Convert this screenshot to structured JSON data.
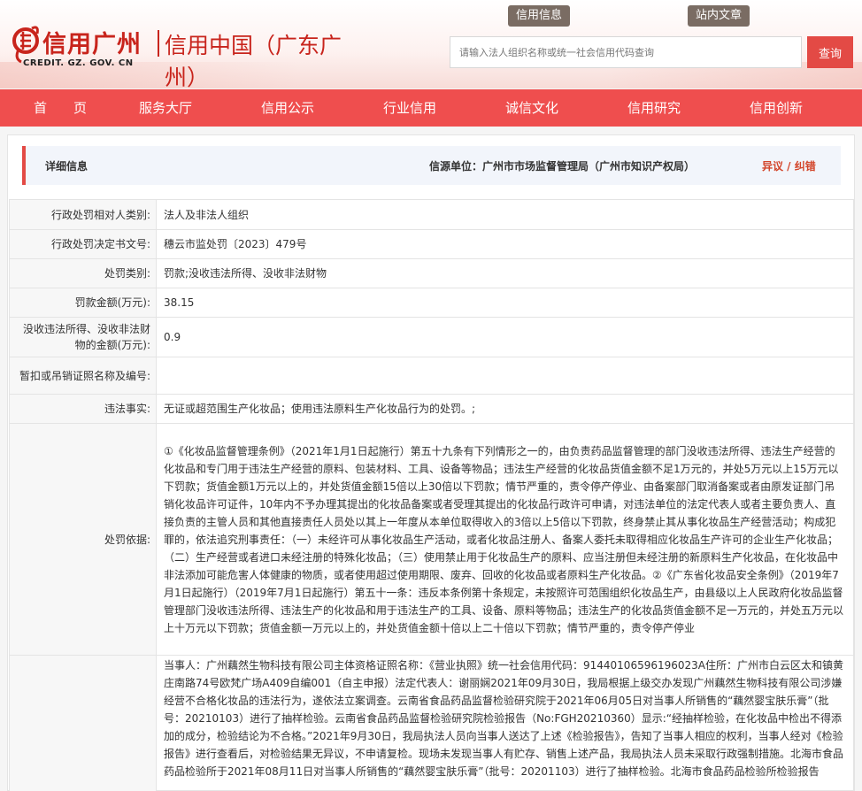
{
  "header": {
    "logo_name": "信用广州",
    "logo_domain": "CREDIT. GZ. GOV. CN",
    "logo_sub": "信用中国（广东广州）",
    "top_links": [
      "信用信息",
      "站内文章"
    ],
    "search_placeholder": "请输入法人组织名称或统一社会信用代码查询",
    "search_button": "查询"
  },
  "nav": {
    "items": [
      "首　　页",
      "服务大厅",
      "信用公示",
      "行业信用",
      "诚信文化",
      "信用研究",
      "信用创新"
    ]
  },
  "detail": {
    "title": "详细信息",
    "source": "信源单位：广州市市场监督管理局（广州市知识产权局）",
    "objection": "异议 / 纠错",
    "rows": [
      {
        "label": "行政处罚相对人类别:",
        "value": "法人及非法人组织"
      },
      {
        "label": "行政处罚决定书文号:",
        "value": "穗云市监处罚〔2023〕479号"
      },
      {
        "label": "处罚类别:",
        "value": "罚款;没收违法所得、没收非法财物"
      },
      {
        "label": "罚款金额(万元):",
        "value": "38.15"
      },
      {
        "label": "没收违法所得、没收非法财物的金额(万元):",
        "value": "0.9"
      },
      {
        "label": "暂扣或吊销证照名称及编号:",
        "value": ""
      },
      {
        "label": "违法事实:",
        "value": "无证或超范围生产化妆品；使用违法原料生产化妆品行为的处罚。;"
      },
      {
        "label": "处罚依据:",
        "value": "①《化妆品监督管理条例》（2021年1月1日起施行）第五十九条有下列情形之一的，由负责药品监督管理的部门没收违法所得、违法生产经营的化妆品和专门用于违法生产经营的原料、包装材料、工具、设备等物品；违法生产经营的化妆品货值金额不足1万元的，并处5万元以上15万元以下罚款；货值金额1万元以上的，并处货值金额15倍以上30倍以下罚款；情节严重的，责令停产停业、由备案部门取消备案或者由原发证部门吊销化妆品许可证件，10年内不予办理其提出的化妆品备案或者受理其提出的化妆品行政许可申请，对违法单位的法定代表人或者主要负责人、直接负责的主管人员和其他直接责任人员处以其上一年度从本单位取得收入的3倍以上5倍以下罚款，终身禁止其从事化妆品生产经营活动；构成犯罪的，依法追究刑事责任：（一）未经许可从事化妆品生产活动，或者化妆品注册人、备案人委托未取得相应化妆品生产许可的企业生产化妆品；（二）生产经营或者进口未经注册的特殊化妆品；（三）使用禁止用于化妆品生产的原料、应当注册但未经注册的新原料生产化妆品，在化妆品中非法添加可能危害人体健康的物质，或者使用超过使用期限、废弃、回收的化妆品或者原料生产化妆品。②《广东省化妆品安全条例》（2019年7月1日起施行）（2019年7月1日起施行）第五十一条：违反本条例第十条规定，未按照许可范围组织化妆品生产，由县级以上人民政府化妆品监督管理部门没收违法所得、违法生产的化妆品和用于违法生产的工具、设备、原料等物品；违法生产的化妆品货值金额不足一万元的，并处五万元以上十万元以下罚款；货值金额一万元以上的，并处货值金额十倍以上二十倍以下罚款；情节严重的，责令停产停业"
      },
      {
        "label": "",
        "value": "当事人：广州藕然生物科技有限公司主体资格证照名称：《营业执照》统一社会信用代码：91440106596196023A住所：广州市白云区太和镇黄庄南路74号欧梵广场A409自编001（自主申报）法定代表人：谢丽娴2021年09月30日，我局根据上级交办发现广州藕然生物科技有限公司涉嫌经营不合格化妆品的违法行为，遂依法立案调查。云南省食品药品监督检验研究院于2021年06月05日对当事人所销售的“藕然婴宝肤乐膏”（批号：20210103）进行了抽样检验。云南省食品药品监督检验研究院检验报告（No:FGH20210360）显示:“经抽样检验，在化妆品中检出不得添加的成分，检验结论为不合格。”2021年9月30日，我局执法人员向当事人送达了上述《检验报告》，告知了当事人相应的权利，当事人经对《检验报告》进行查看后，对检验结果无异议，不申请复检。现场未发现当事人有贮存、销售上述产品，我局执法人员未采取行政强制措施。北海市食品药品检验所于2021年08月11日对当事人所销售的“藕然婴宝肤乐膏”（批号：20201103）进行了抽样检验。北海市食品药品检验所检验报告"
      }
    ]
  }
}
